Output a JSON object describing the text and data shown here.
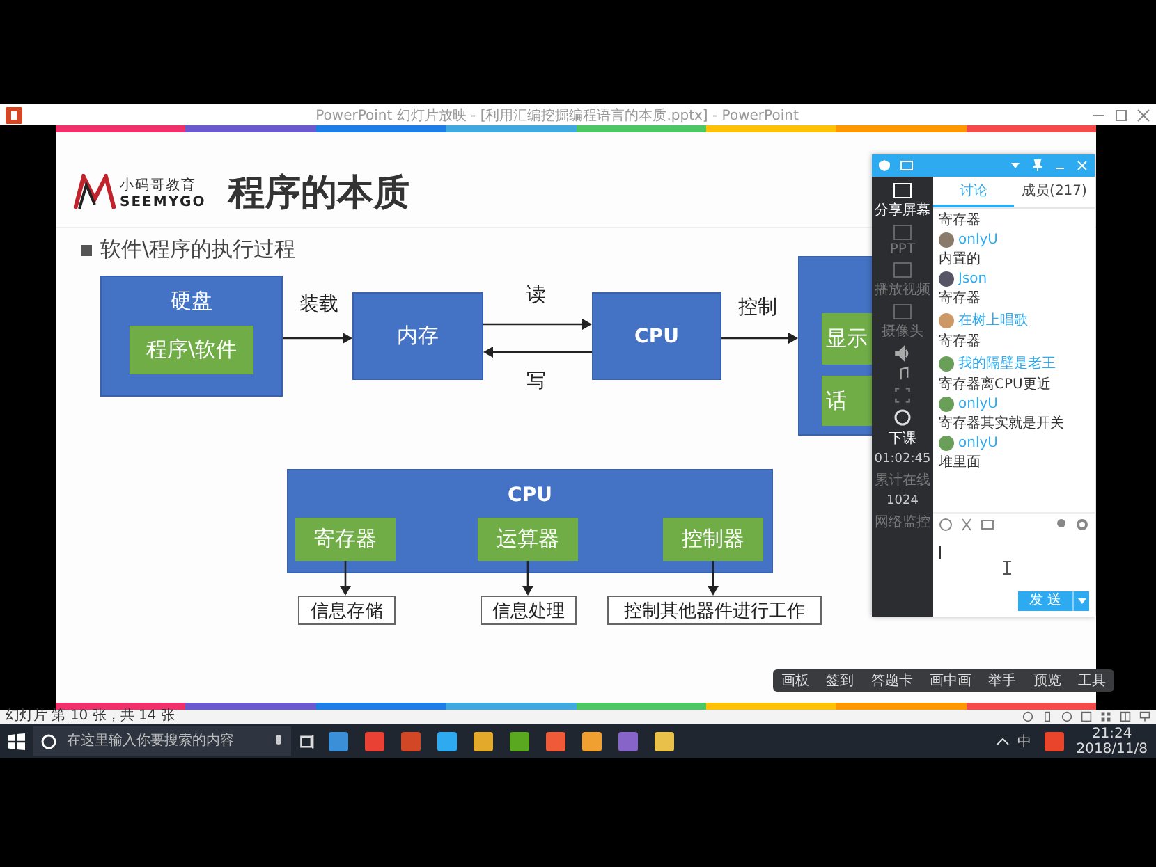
{
  "window": {
    "title": "PowerPoint 幻灯片放映 - [利用汇编挖掘编程语言的本质.pptx] - PowerPoint"
  },
  "slide": {
    "brand": "小码哥教育",
    "brand_en": "SEEMYGO",
    "title": "程序的本质",
    "bullet": "软件\\程序的执行过程",
    "flow": {
      "disk": "硬盘",
      "program": "程序\\软件",
      "load": "装载",
      "memory": "内存",
      "read": "读",
      "write": "写",
      "cpu": "CPU",
      "control": "控制",
      "output_1": "显示",
      "output_2": "话"
    },
    "cpu_block": {
      "title": "CPU",
      "units": [
        {
          "name": "寄存器",
          "role": "信息存储"
        },
        {
          "name": "运算器",
          "role": "信息处理"
        },
        {
          "name": "控制器",
          "role": "控制其他器件进行工作"
        }
      ]
    }
  },
  "chat": {
    "side_tools": [
      {
        "label": "分享屏幕",
        "selected": true
      },
      {
        "label": "PPT",
        "selected": false
      },
      {
        "label": "播放视频",
        "selected": false
      },
      {
        "label": "摄像头",
        "selected": false
      }
    ],
    "end_label": "下课",
    "timer": "01:02:45",
    "online_label": "累计在线",
    "online_count": "1024",
    "network_label": "网络监控",
    "tabs": [
      {
        "label": "讨论",
        "selected": true
      },
      {
        "label": "成员(217)",
        "selected": false
      }
    ],
    "messages": [
      {
        "text": "寄存器"
      },
      {
        "user": "onlyU",
        "text": "内置的"
      },
      {
        "user": "Json",
        "text": "寄存器"
      },
      {
        "user": "在树上唱歌",
        "text": "寄存器"
      },
      {
        "user": "我的隔壁是老王",
        "text": "寄存器离CPU更近"
      },
      {
        "user": "onlyU",
        "text": "寄存器其实就是开关"
      },
      {
        "user": "onlyU",
        "text": "堆里面"
      }
    ],
    "send_label": "发 送"
  },
  "class_toolbar": [
    "画板",
    "签到",
    "答题卡",
    "画中画",
    "举手",
    "预览",
    "工具"
  ],
  "status_bar": {
    "slide_info": "幻灯片 第 10 张，共 14 张"
  },
  "taskbar": {
    "search_placeholder": "在这里输入你要搜索的内容",
    "ime": "中",
    "time": "21:24",
    "date": "2018/11/8"
  }
}
